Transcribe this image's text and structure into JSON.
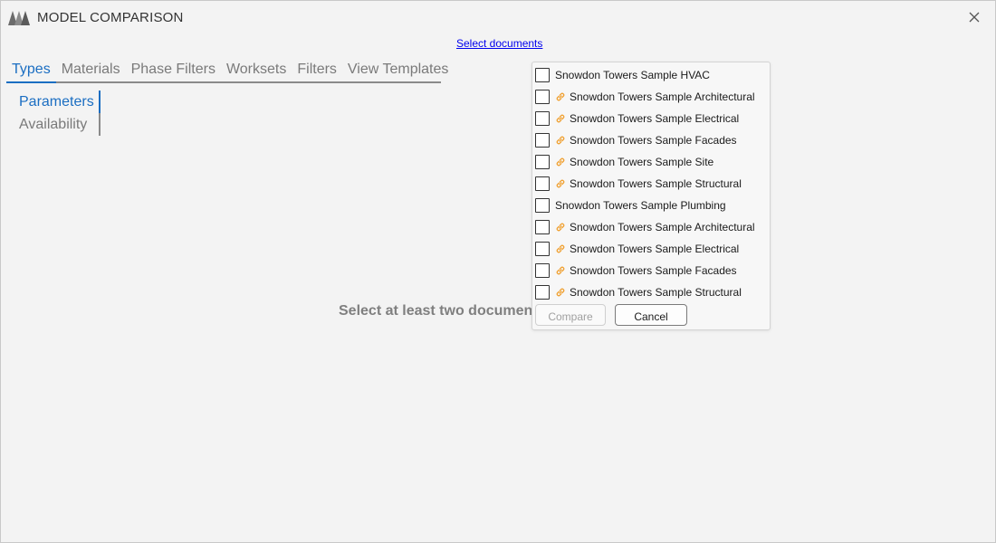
{
  "app": {
    "title": "MODEL COMPARISON",
    "logo_icon": "logo-icon",
    "close_icon": "close-icon"
  },
  "select_documents_link": "Select documents",
  "tabs": [
    {
      "label": "Types",
      "active": true
    },
    {
      "label": "Materials",
      "active": false
    },
    {
      "label": "Phase Filters",
      "active": false
    },
    {
      "label": "Worksets",
      "active": false
    },
    {
      "label": "Filters",
      "active": false
    },
    {
      "label": "View Templates",
      "active": false
    }
  ],
  "subnav": [
    {
      "label": "Parameters",
      "active": true
    },
    {
      "label": "Availability",
      "active": false
    }
  ],
  "placeholder_message": "Select at least two documents",
  "colors": {
    "accent": "#1b6ec2",
    "link_icon": "#f0a030",
    "hyperlink": "#0000ee"
  },
  "document_panel": {
    "documents": [
      {
        "label": "Snowdon Towers Sample HVAC",
        "checked": false,
        "linked": false
      },
      {
        "label": "Snowdon Towers Sample Architectural",
        "checked": false,
        "linked": true
      },
      {
        "label": "Snowdon Towers Sample Electrical",
        "checked": false,
        "linked": true
      },
      {
        "label": "Snowdon Towers Sample Facades",
        "checked": false,
        "linked": true
      },
      {
        "label": "Snowdon Towers Sample Site",
        "checked": false,
        "linked": true
      },
      {
        "label": "Snowdon Towers Sample Structural",
        "checked": false,
        "linked": true
      },
      {
        "label": "Snowdon Towers Sample Plumbing",
        "checked": false,
        "linked": false
      },
      {
        "label": "Snowdon Towers Sample Architectural",
        "checked": false,
        "linked": true
      },
      {
        "label": "Snowdon Towers Sample Electrical",
        "checked": false,
        "linked": true
      },
      {
        "label": "Snowdon Towers Sample Facades",
        "checked": false,
        "linked": true
      },
      {
        "label": "Snowdon Towers Sample Structural",
        "checked": false,
        "linked": true
      }
    ],
    "compare_label": "Compare",
    "compare_enabled": false,
    "cancel_label": "Cancel"
  }
}
